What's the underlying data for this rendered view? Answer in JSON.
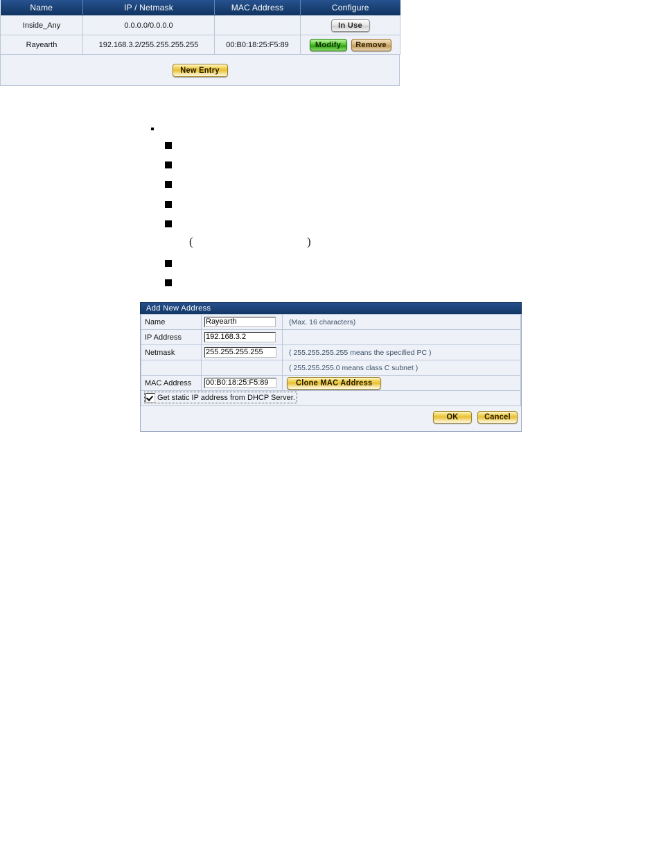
{
  "page": {
    "background": "#ffffff",
    "bullets": {
      "dot_marker": "•",
      "square_marker": "■",
      "open_paren": "(",
      "close_paren": ")",
      "square_count": 7
    }
  },
  "add_address_form": {
    "title": "Add New Address",
    "fields": [
      {
        "label": "Name",
        "value": "Rayearth",
        "hint": "(Max. 16 characters)"
      },
      {
        "label": "IP Address",
        "value": "192.168.3.2",
        "hint": ""
      },
      {
        "label": "Netmask",
        "value": "255.255.255.255",
        "hint": "( 255.255.255.255 means the specified PC )"
      }
    ],
    "netmask_hint_2": "( 255.255.255.0 means class C subnet )",
    "mac": {
      "label": "MAC Address",
      "value": "00:B0:18:25:F5:89",
      "clone_button_label": "Clone MAC Address"
    },
    "dhcp_checkbox": {
      "label": "Get static IP address from DHCP Server.",
      "checked": true
    },
    "ok_label": "OK",
    "cancel_label": "Cancel"
  },
  "address_list": {
    "columns": [
      "Name",
      "IP / Netmask",
      "MAC Address",
      "Configure"
    ],
    "rows": [
      {
        "name": "Inside_Any",
        "ip_netmask": "0.0.0.0/0.0.0.0",
        "mac_address": "",
        "actions": [
          {
            "label": "In Use",
            "style": "gray"
          }
        ]
      },
      {
        "name": "Rayearth",
        "ip_netmask": "192.168.3.2/255.255.255.255",
        "mac_address": "00:B0:18:25:F5:89",
        "actions": [
          {
            "label": "Modify",
            "style": "green"
          },
          {
            "label": "Remove",
            "style": "tan"
          }
        ]
      }
    ],
    "new_entry_label": "New Entry"
  },
  "colors": {
    "titlebar": "#1b3f79",
    "panel_bg": "#eef2f8",
    "border": "#b9c6d8",
    "gold": "#e8c033",
    "green": "#2ea314",
    "tan": "#c09a5a",
    "gray": "#cfcfcf"
  }
}
